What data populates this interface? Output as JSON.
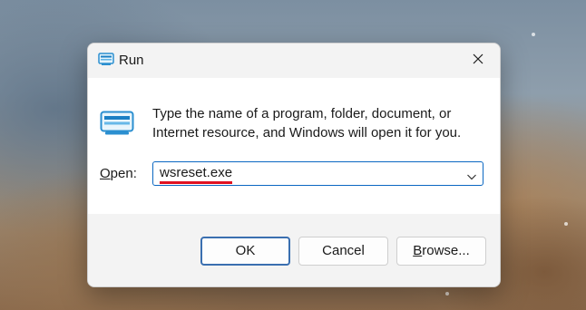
{
  "window": {
    "title": "Run",
    "close_icon": "close-icon",
    "title_icon": "run-app-icon"
  },
  "content": {
    "description": "Type the name of a program, folder, document, or Internet resource, and Windows will open it for you.",
    "open_label_underlined": "O",
    "open_label_rest": "pen:",
    "input_value": "wsreset.exe",
    "dropdown_icon": "chevron-down-icon",
    "annotation_color": "#e01020"
  },
  "buttons": {
    "ok": "OK",
    "cancel": "Cancel",
    "browse_underlined": "B",
    "browse_rest": "rowse..."
  },
  "colors": {
    "accent": "#0b67c2",
    "dialog_background": "#ffffff",
    "footer_background": "#f3f3f3"
  }
}
